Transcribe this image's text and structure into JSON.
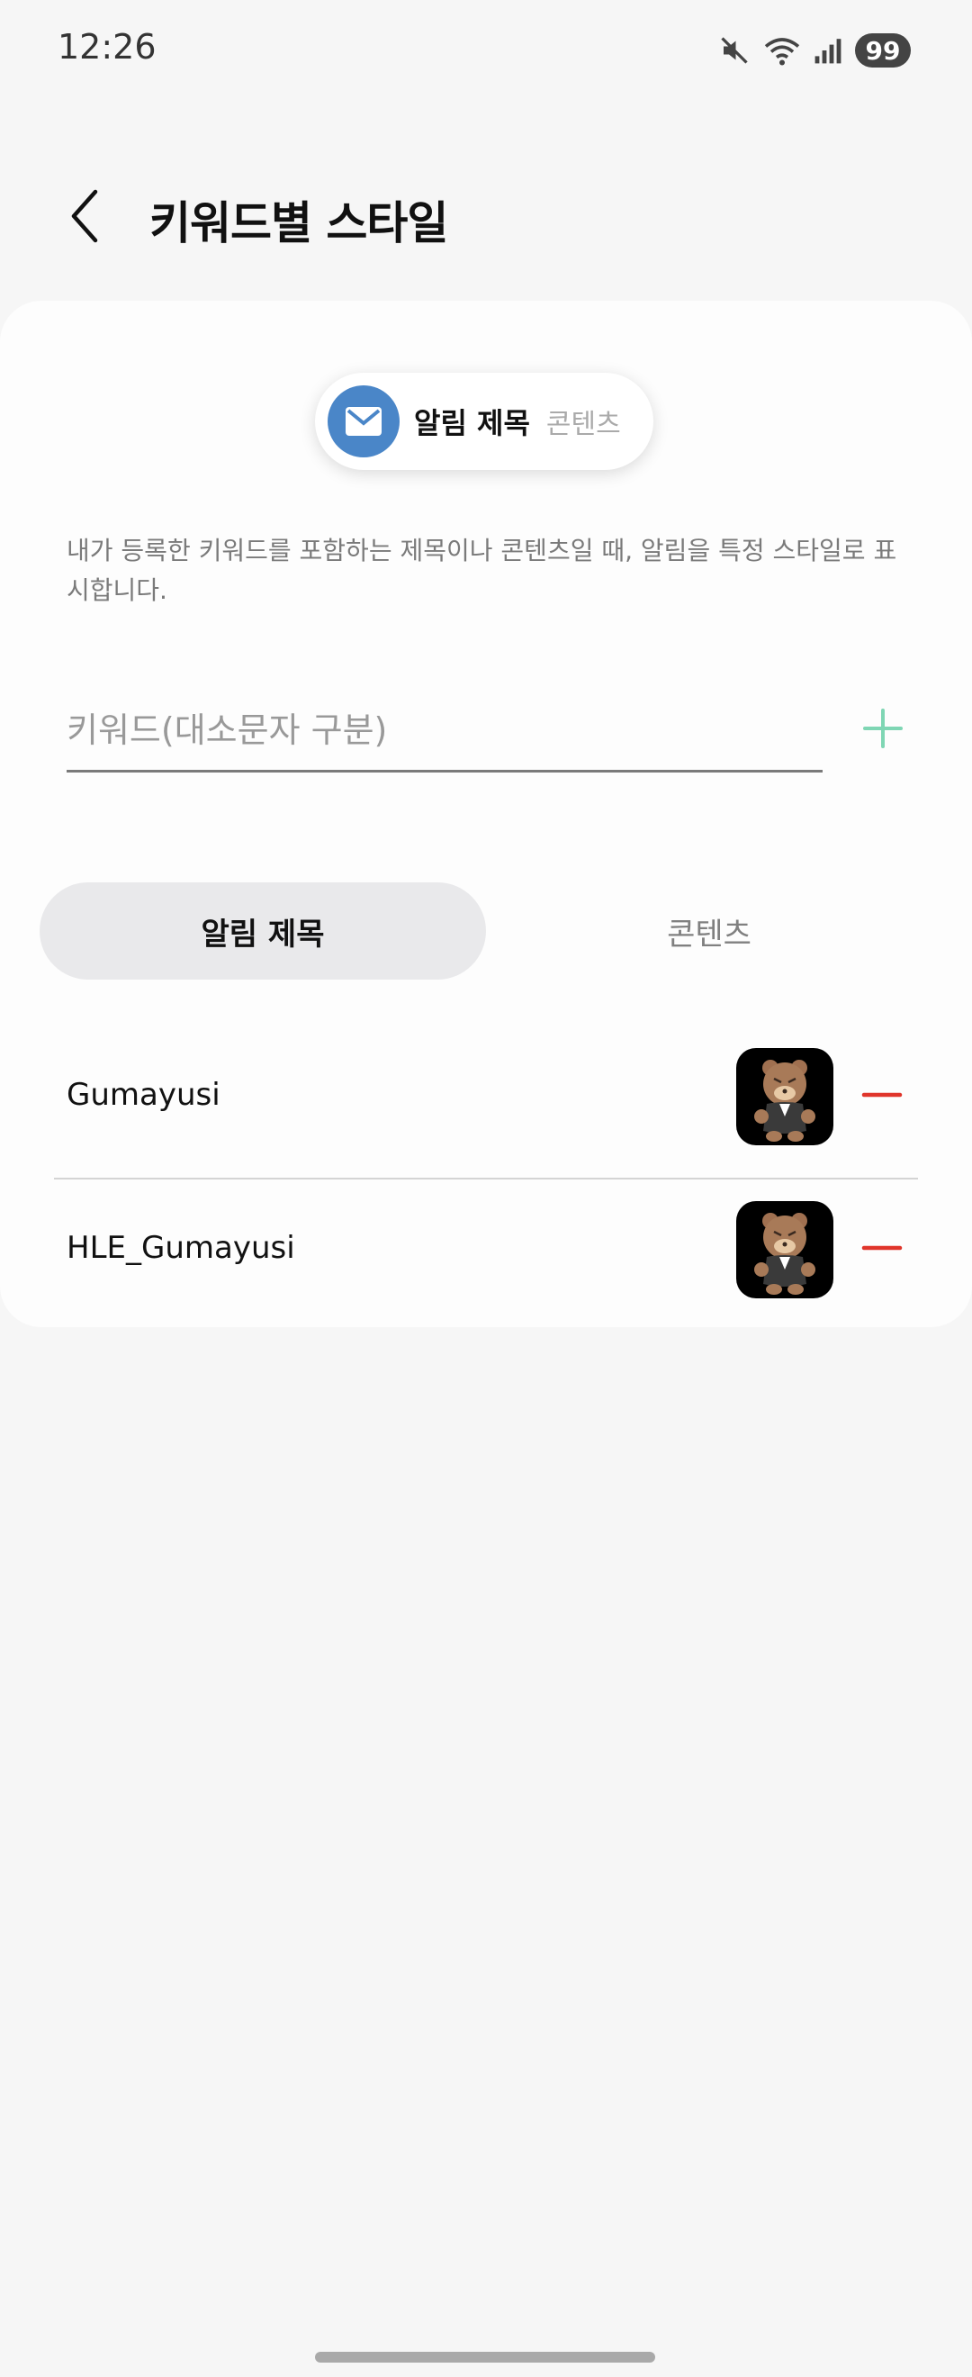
{
  "status_bar": {
    "time": "12:26",
    "battery": "99",
    "icons": [
      "mute-icon",
      "wifi-icon",
      "signal-icon",
      "battery-icon"
    ]
  },
  "header": {
    "back_icon": "chevron-left-icon",
    "title": "키워드별 스타일"
  },
  "preview": {
    "icon": "mail-icon",
    "title": "알림 제목",
    "content": "콘텐츠"
  },
  "description": "내가 등록한 키워드를 포함하는 제목이나 콘텐츠일 때, 알림을 특정 스타일로 표시합니다.",
  "keyword_input": {
    "value": "",
    "placeholder": "키워드(대소문자 구분)"
  },
  "tabs": [
    {
      "label": "알림 제목",
      "selected": true
    },
    {
      "label": "콘텐츠",
      "selected": false
    }
  ],
  "keywords": [
    {
      "label": "Gumayusi",
      "thumb": "bear-sticker-thumbnail"
    },
    {
      "label": "HLE_Gumayusi",
      "thumb": "bear-sticker-thumbnail"
    }
  ],
  "colors": {
    "accent_add": "#7fd6b4",
    "remove": "#e0352b",
    "preview_icon_bg": "#4a86c8",
    "tab_active_bg": "#e9e9eb"
  }
}
